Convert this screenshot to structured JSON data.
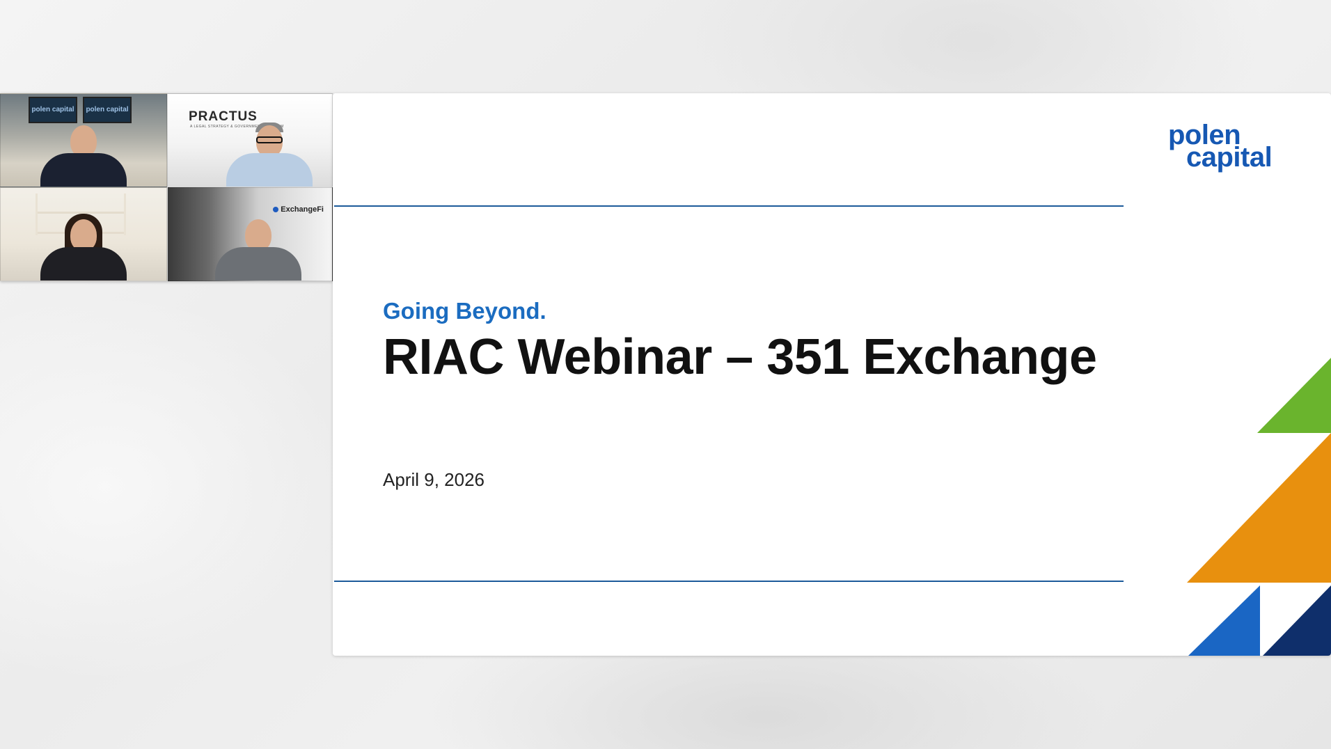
{
  "participants": [
    {
      "screen_labels": [
        "polen capital",
        "polen capital"
      ]
    },
    {
      "logo": "PRACTUS",
      "logo_sub": "A LEGAL STRATEGY & GOVERNMENT LAW FIRM"
    },
    {},
    {
      "logo": "ExchangeFi"
    }
  ],
  "slide": {
    "brand": {
      "line1": "polen",
      "line2": "capital"
    },
    "tagline": "Going Beyond.",
    "title": "RIAC Webinar – 351 Exchange",
    "date": "April 9, 2026"
  },
  "colors": {
    "brand_blue": "#1658b3",
    "rule_blue": "#1c5a9a",
    "shape_green": "#6ab42d",
    "shape_orange": "#e8900e",
    "shape_blue": "#1a66c4",
    "shape_navy": "#0f2f6b"
  }
}
